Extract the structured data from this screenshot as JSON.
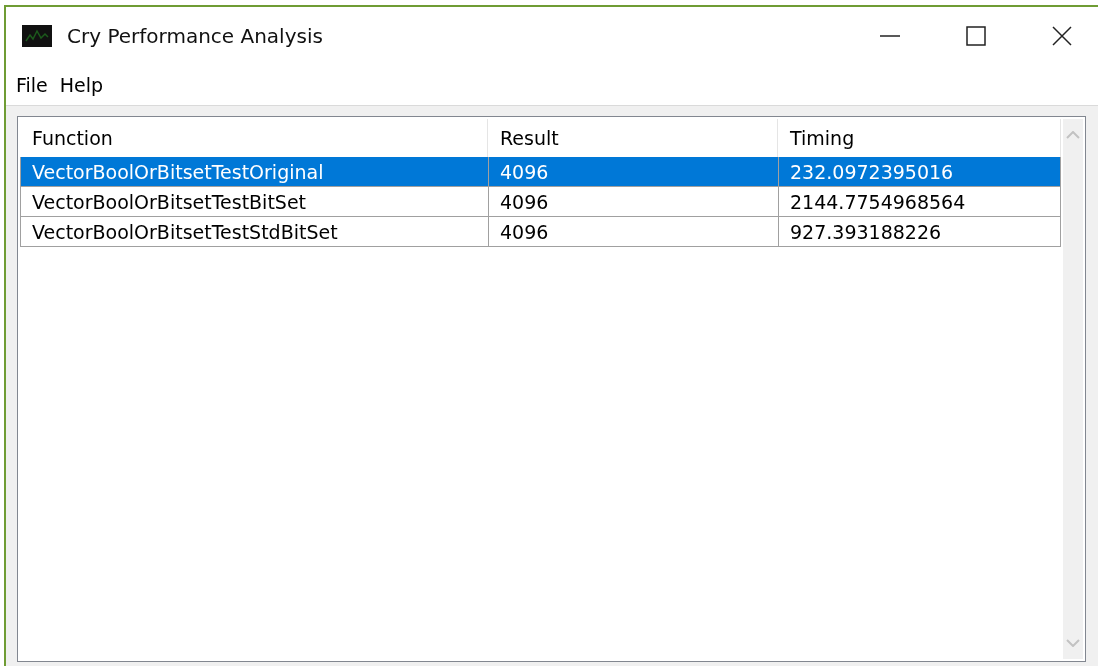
{
  "window": {
    "title": "Cry Performance Analysis"
  },
  "menu": [
    "File",
    "Help"
  ],
  "table": {
    "columns": [
      "Function",
      "Result",
      "Timing"
    ],
    "rows": [
      {
        "cells": [
          "VectorBoolOrBitsetTestOriginal",
          "4096",
          "232.0972395016"
        ],
        "selected": true
      },
      {
        "cells": [
          "VectorBoolOrBitsetTestBitSet",
          "4096",
          "2144.7754968564"
        ],
        "selected": false
      },
      {
        "cells": [
          "VectorBoolOrBitsetTestStdBitSet",
          "4096",
          "927.393188226"
        ],
        "selected": false
      }
    ]
  }
}
